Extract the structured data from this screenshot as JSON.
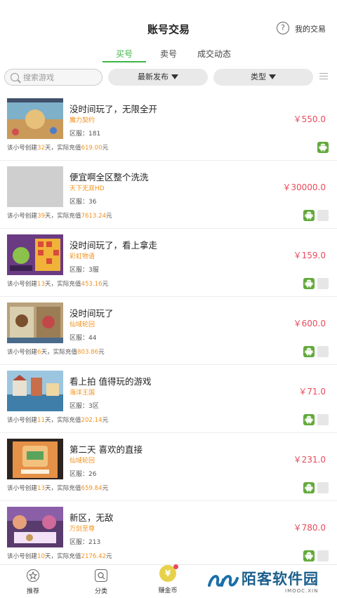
{
  "header": {
    "title": "账号交易",
    "help_symbol": "?",
    "my_trade": "我的交易"
  },
  "tabs": [
    {
      "label": "买号",
      "active": true
    },
    {
      "label": "卖号",
      "active": false
    },
    {
      "label": "成交动态",
      "active": false
    }
  ],
  "filters": {
    "search_placeholder": "搜索游戏",
    "sort_label": "最新发布",
    "type_label": "类型"
  },
  "colors": {
    "accent": "#3cb544",
    "price": "#e94a5b",
    "game": "#f2921c",
    "android": "#63a93c"
  },
  "listings": [
    {
      "title": "没时间玩了，无限全开",
      "game": "魔力契约",
      "server": "区服：181",
      "price": "￥550.0",
      "meta_prefix": "该小号创建",
      "days": "32",
      "meta_mid": "天，实际充值",
      "amount": "619.00",
      "meta_suffix": "元",
      "thumb": "thumb1",
      "has_extra": false
    },
    {
      "title": "便宜啊全区整个洗洗",
      "game": "天下无双HD",
      "server": "区服：36",
      "price": "￥30000.0",
      "meta_prefix": "该小号创建",
      "days": "39",
      "meta_mid": "天，实际充值",
      "amount": "7613.24",
      "meta_suffix": "元",
      "thumb": "blank",
      "has_extra": true
    },
    {
      "title": "没时间玩了，看上拿走",
      "game": "彩虹物语",
      "server": "区服：3服",
      "price": "￥159.0",
      "meta_prefix": "该小号创建",
      "days": "13",
      "meta_mid": "天，实际充值",
      "amount": "453.16",
      "meta_suffix": "元",
      "thumb": "thumb3",
      "has_extra": true
    },
    {
      "title": "没时间玩了",
      "game": "仙域轮回",
      "server": "区服：44",
      "price": "￥600.0",
      "meta_prefix": "该小号创建",
      "days": "6",
      "meta_mid": "天，实际充值",
      "amount": "803.86",
      "meta_suffix": "元",
      "thumb": "thumb4",
      "has_extra": true
    },
    {
      "title": "看上拍 值得玩的游戏",
      "game": "海洋王国",
      "server": "区服：3区",
      "price": "￥71.0",
      "meta_prefix": "该小号创建",
      "days": "11",
      "meta_mid": "天，实际充值",
      "amount": "202.14",
      "meta_suffix": "元",
      "thumb": "thumb5",
      "has_extra": true
    },
    {
      "title": "第二天  喜欢的直接",
      "game": "仙域轮回",
      "server": "区服：26",
      "price": "￥231.0",
      "meta_prefix": "该小号创建",
      "days": "13",
      "meta_mid": "天，实际充值",
      "amount": "659.84",
      "meta_suffix": "元",
      "thumb": "thumb6",
      "has_extra": true
    },
    {
      "title": "新区，无敌",
      "game": "万剑至尊",
      "server": "区服：213",
      "price": "￥780.0",
      "meta_prefix": "该小号创建",
      "days": "10",
      "meta_mid": "天，实际充值",
      "amount": "2176.42",
      "meta_suffix": "元",
      "thumb": "thumb7",
      "has_extra": true
    }
  ],
  "bottom_nav": [
    {
      "label": "推荐",
      "icon": "star-icon"
    },
    {
      "label": "分类",
      "icon": "category-icon"
    },
    {
      "label": "赚金币",
      "icon": "coin-icon",
      "coin_symbol": "¥"
    }
  ],
  "watermark": {
    "text": "陌客软件园",
    "sub": "IMOOC.XIN"
  }
}
